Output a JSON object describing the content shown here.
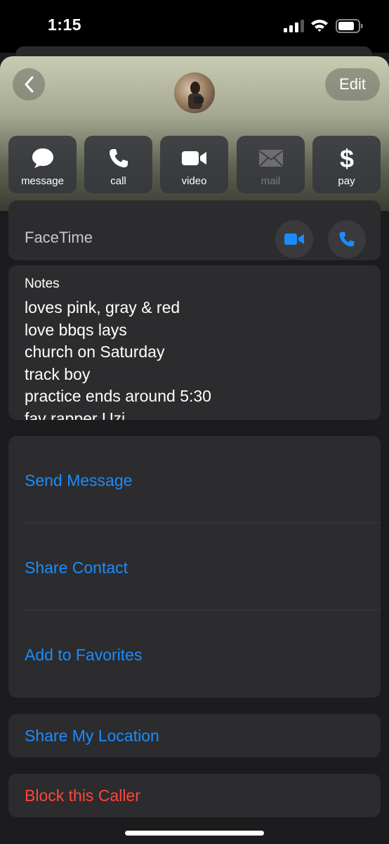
{
  "status_bar": {
    "time": "1:15"
  },
  "header": {
    "back_icon": "chevron-left-icon",
    "edit_label": "Edit"
  },
  "actions": [
    {
      "label": "message",
      "icon": "message-bubble-icon",
      "enabled": true
    },
    {
      "label": "call",
      "icon": "phone-icon",
      "enabled": true
    },
    {
      "label": "video",
      "icon": "video-camera-icon",
      "enabled": true
    },
    {
      "label": "mail",
      "icon": "envelope-icon",
      "enabled": false
    },
    {
      "label": "pay",
      "icon": "dollar-icon",
      "enabled": true
    }
  ],
  "facetime": {
    "label": "FaceTime"
  },
  "notes": {
    "title": "Notes",
    "lines": [
      "loves pink, gray & red",
      "love bbqs lays",
      "church on Saturday",
      "track boy",
      "practice ends around 5:30",
      "fav rapper Uzi"
    ]
  },
  "options": [
    "Send Message",
    "Share Contact",
    "Add to Favorites"
  ],
  "share_location": "Share My Location",
  "block_caller": "Block this Caller",
  "colors": {
    "link": "#1a8cff",
    "destructive": "#ff453a",
    "card": "#2c2c2e",
    "background": "#1c1c1e"
  }
}
